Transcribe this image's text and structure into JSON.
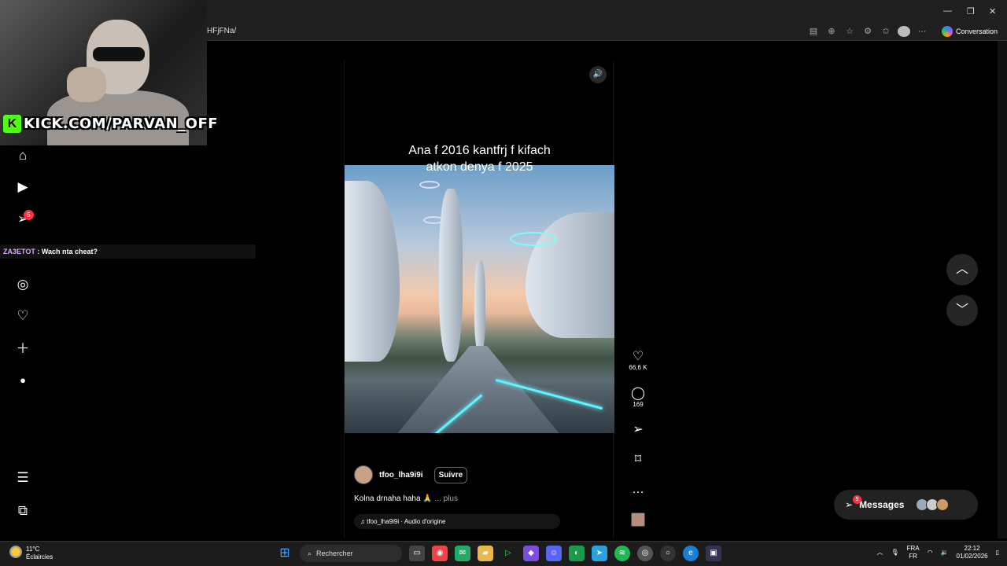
{
  "browser": {
    "url_fragment": "HFjFNa/",
    "copilot_label": "Conversation"
  },
  "stream": {
    "kick_logo": "K",
    "kick_url": "KICK.COM/PARVAN_OFF",
    "chat_user": "ZA3ETOT",
    "chat_message": " : Wach nta cheat?"
  },
  "sidenav": {
    "notification_count": "5"
  },
  "reel": {
    "caption_line1": "Ana f 2016 kantfrj f kifach",
    "caption_line2": "atkon denya f 2025",
    "author": "tfoo_lha9i9i",
    "follow_label": "Suivre",
    "description": "Kolna drnaha haha 🙏",
    "more_label": "... plus",
    "audio": "tfoo_lha9i9i · Audio d'origine"
  },
  "actions": {
    "likes": "66,6 K",
    "comments": "169"
  },
  "messages": {
    "label": "Messages",
    "badge": "5"
  },
  "taskbar": {
    "temperature": "11°C",
    "weather": "Éclaircies",
    "search_placeholder": "Rechercher",
    "lang_top": "FRA",
    "lang_bottom": "FR",
    "time": "22:12",
    "date": "01/02/2026"
  },
  "colors": {
    "kick_green": "#53fc18",
    "notification_red": "#ff3040",
    "accent_glow": "#5ef4ff"
  }
}
